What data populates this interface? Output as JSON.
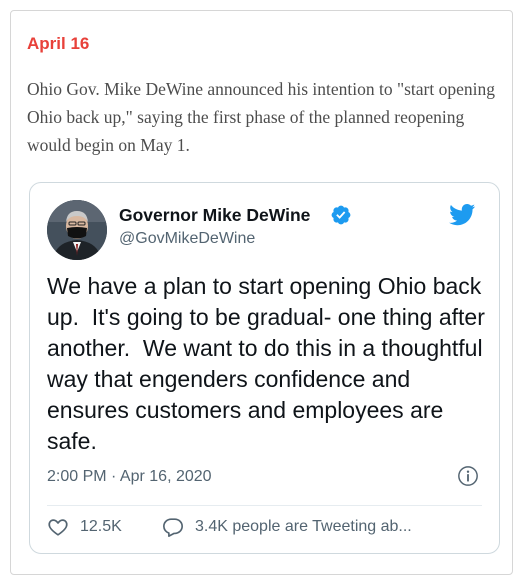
{
  "article": {
    "date_label": "April 16",
    "summary": "Ohio Gov. Mike DeWine announced his intention to \"start opening Ohio back up,\" saying the first phase of the planned reopening would begin on May 1."
  },
  "tweet": {
    "author_name": "Governor Mike DeWine",
    "handle": "@GovMikeDeWine",
    "text": "We have a plan to start opening Ohio back up.  It's going to be gradual- one thing after another.  We want to do this in a thoughtful way that engenders confidence and ensures customers and employees are safe.",
    "timestamp": "2:00 PM · Apr 16, 2020",
    "like_count": "12.5K",
    "reply_label": "3.4K people are Tweeting ab...",
    "icons": [
      "avatar",
      "verified-badge-icon",
      "twitter-bird-icon",
      "info-icon",
      "heart-icon",
      "speech-bubble-icon"
    ]
  },
  "colors": {
    "date_accent": "#e8413a",
    "twitter_blue": "#1d9bf0",
    "secondary_text": "#536471"
  }
}
